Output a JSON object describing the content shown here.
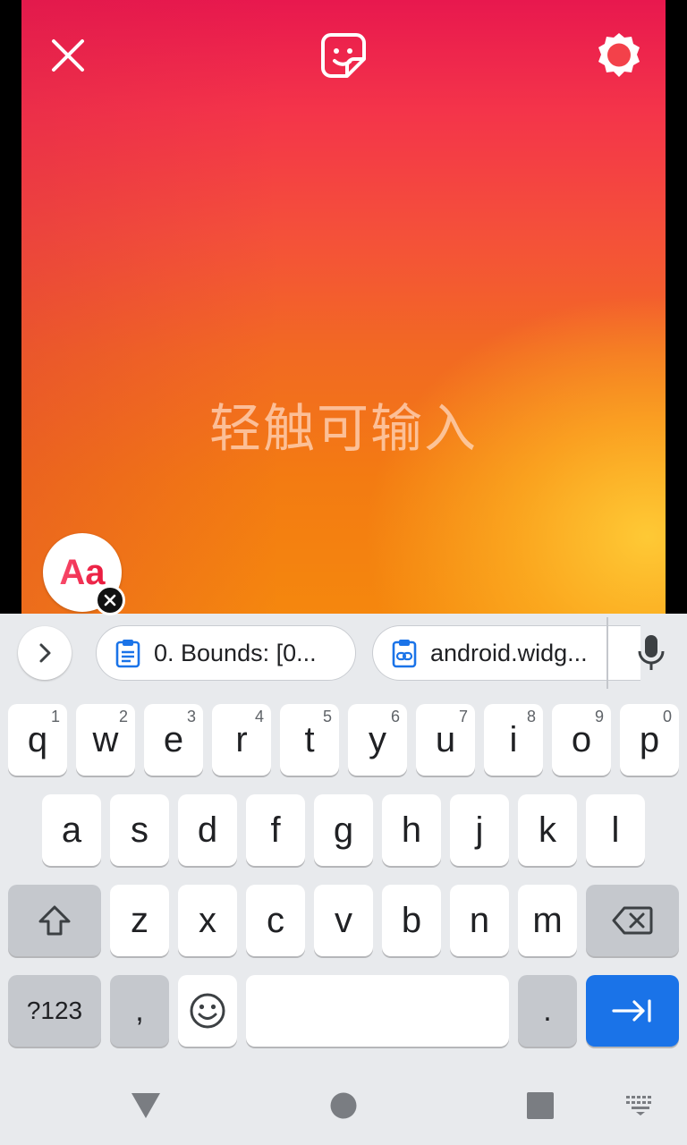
{
  "canvas": {
    "placeholder": "轻触可输入",
    "font_button_label": "Aa"
  },
  "icons": {
    "close": "close-icon",
    "sticker": "sticker-icon",
    "settings": "settings-gear-icon",
    "dismiss": "close-small-icon",
    "expand": "chevron-right-icon",
    "clipboard": "clipboard-icon",
    "clipboard_link": "clipboard-link-icon",
    "mic": "microphone-icon",
    "shift": "shift-icon",
    "backspace": "backspace-icon",
    "emoji": "emoji-icon",
    "enter": "tab-next-icon",
    "nav_back": "triangle-back-icon",
    "nav_home": "circle-home-icon",
    "nav_recents": "square-recents-icon",
    "nav_keyboard": "keyboard-switch-icon"
  },
  "suggestions": {
    "chip1": "0. Bounds: [0...",
    "chip2": "android.widg..."
  },
  "keyboard": {
    "row1": [
      {
        "key": "q",
        "hint": "1"
      },
      {
        "key": "w",
        "hint": "2"
      },
      {
        "key": "e",
        "hint": "3"
      },
      {
        "key": "r",
        "hint": "4"
      },
      {
        "key": "t",
        "hint": "5"
      },
      {
        "key": "y",
        "hint": "6"
      },
      {
        "key": "u",
        "hint": "7"
      },
      {
        "key": "i",
        "hint": "8"
      },
      {
        "key": "o",
        "hint": "9"
      },
      {
        "key": "p",
        "hint": "0"
      }
    ],
    "row2": [
      "a",
      "s",
      "d",
      "f",
      "g",
      "h",
      "j",
      "k",
      "l"
    ],
    "row3": [
      "z",
      "x",
      "c",
      "v",
      "b",
      "n",
      "m"
    ],
    "symbols_label": "?123",
    "comma": ",",
    "period": "."
  },
  "colors": {
    "accent": "#1a73e8",
    "canvas_top": "#e8184e",
    "canvas_bottom": "#f5870e",
    "canvas_glow": "#ffcd37"
  }
}
